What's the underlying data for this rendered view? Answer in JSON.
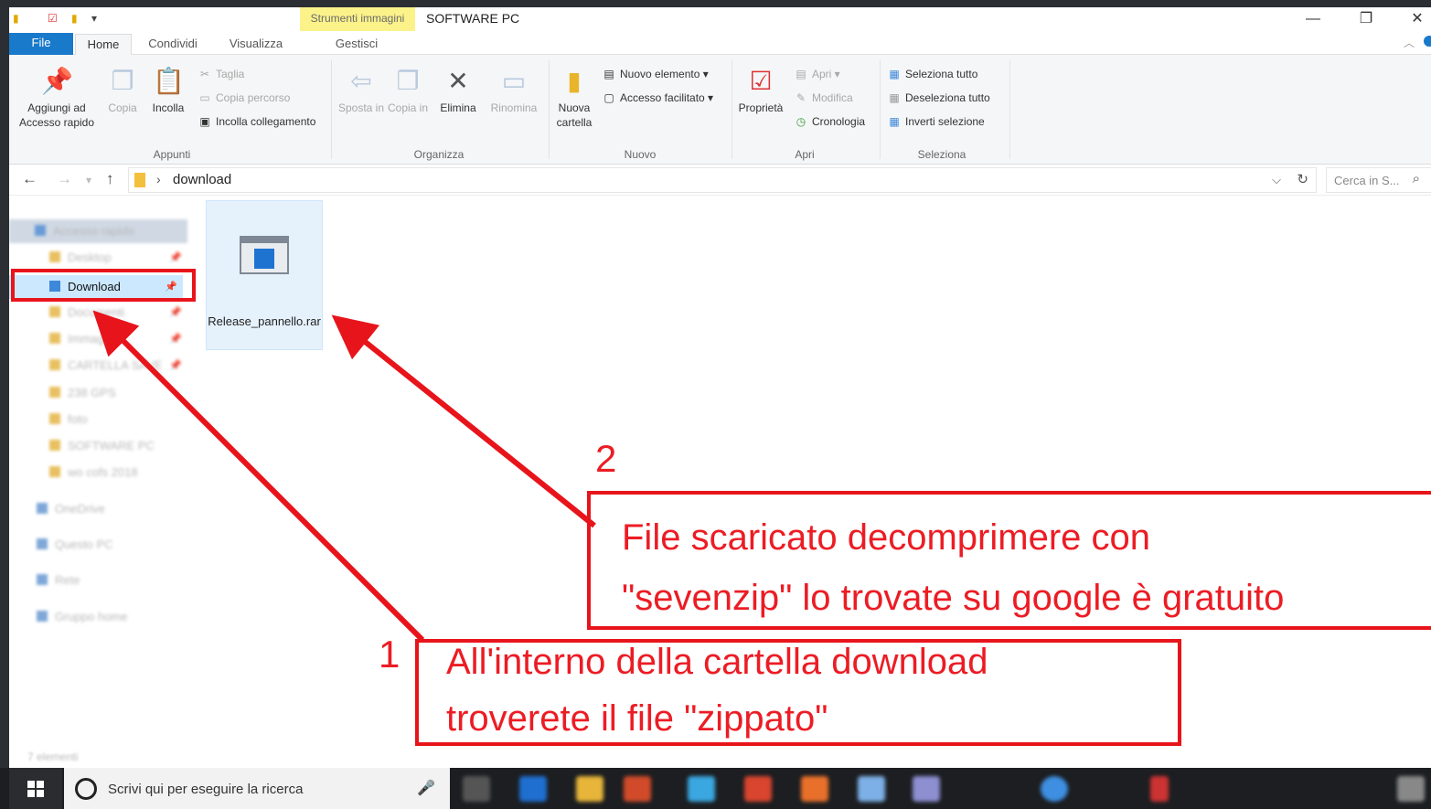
{
  "window": {
    "title": "SOFTWARE PC",
    "contextual_tab": "Strumenti immagini",
    "buttons": {
      "minimize": "—",
      "restore": "❐",
      "close": "✕"
    }
  },
  "ribbon_tabs": {
    "file": "File",
    "home": "Home",
    "share": "Condividi",
    "view": "Visualizza",
    "manage": "Gestisci"
  },
  "ribbon": {
    "clipboard": {
      "label": "Appunti",
      "pin": "Aggiungi ad Accesso rapido",
      "copy": "Copia",
      "paste": "Incolla",
      "cut": "Taglia",
      "copy_path": "Copia percorso",
      "paste_shortcut": "Incolla collegamento"
    },
    "organize": {
      "label": "Organizza",
      "move": "Sposta in",
      "copy_to": "Copia in",
      "delete": "Elimina",
      "rename": "Rinomina"
    },
    "new": {
      "label": "Nuovo",
      "new_folder": "Nuova cartella",
      "new_item": "Nuovo elemento",
      "easy_access": "Accesso facilitato"
    },
    "open": {
      "label": "Apri",
      "properties": "Proprietà",
      "open": "Apri",
      "edit": "Modifica",
      "history": "Cronologia"
    },
    "select": {
      "label": "Seleziona",
      "select_all": "Seleziona tutto",
      "select_none": "Deseleziona tutto",
      "invert": "Inverti selezione"
    }
  },
  "address": {
    "path": "download",
    "separator": "›",
    "search_placeholder": "Cerca in S..."
  },
  "nav": {
    "quick_access": "Accesso rapido",
    "items": [
      "Desktop",
      "Download",
      "Documenti",
      "Immagini",
      "CARTELLA SAVE",
      "238 GPS",
      "foto",
      "SOFTWARE PC",
      "wo cofs 2018"
    ],
    "onedrive": "OneDrive",
    "this_pc": "Questo PC",
    "network": "Rete",
    "homegroup": "Gruppo home"
  },
  "file": {
    "name": "Release_pannello.rar"
  },
  "status": {
    "items": "7 elementi"
  },
  "annotations": {
    "num1": "1",
    "num2": "2",
    "note1_line1": "All'interno della cartella download",
    "note1_line2": "troverete il file \"zippato\"",
    "note2_line1": "File scaricato decomprimere con",
    "note2_line2": " \"sevenzip\" lo trovate su google è gratuito"
  },
  "taskbar": {
    "search_text": "Scrivi qui per eseguire la ricerca"
  },
  "colors": {
    "accent": "#1979ca",
    "annotation_red": "#ec1c24",
    "contextual_tab": "#fbf28a",
    "selection": "#cce8ff"
  }
}
